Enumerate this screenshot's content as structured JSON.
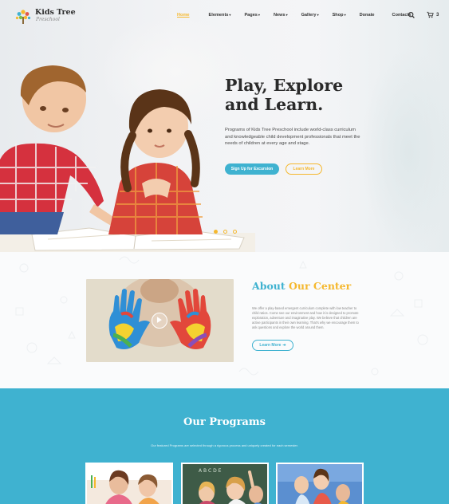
{
  "logo": {
    "title": "Kids Tree",
    "subtitle": "Preschool"
  },
  "nav": {
    "items": [
      {
        "label": "Home",
        "active": true,
        "dropdown": false
      },
      {
        "label": "Elements",
        "active": false,
        "dropdown": true
      },
      {
        "label": "Pages",
        "active": false,
        "dropdown": true
      },
      {
        "label": "News",
        "active": false,
        "dropdown": true
      },
      {
        "label": "Gallery",
        "active": false,
        "dropdown": true
      },
      {
        "label": "Shop",
        "active": false,
        "dropdown": true
      },
      {
        "label": "Donate",
        "active": false,
        "dropdown": false
      },
      {
        "label": "Contacts",
        "active": false,
        "dropdown": false
      }
    ],
    "cart_count": "3",
    "search_icon": "search-icon",
    "cart_icon": "cart-icon"
  },
  "hero": {
    "title_line1": "Play, Explore",
    "title_line2": "and Learn.",
    "description": "Programs of Kids Tree Preschool include world-class curriculum and knowledgeable child development professionals that meet the needs of children at every age and stage.",
    "primary_button": "Sign Up for Excursion",
    "secondary_button": "Learn More",
    "slides": 3,
    "active_slide": 1
  },
  "about": {
    "title_part1": "About",
    "title_part2": "Our Center",
    "text": "We offer a play-based emergent curriculum complete with low teacher to child ratios. Come see our environment and how it is designed to promote exploration, adventure and imaginative play. We believe that children are active participants in their own learning. That's why we encourage them to ask questions and explore the world around them.",
    "button": "Learn More"
  },
  "programs": {
    "title": "Our Programs",
    "subtitle": "Our featured Programs are selected through a rigorous process and uniquely created for each semester."
  },
  "colors": {
    "accent_yellow": "#f5b82e",
    "accent_blue": "#3fb2d0",
    "heading": "#2a2a2a"
  }
}
